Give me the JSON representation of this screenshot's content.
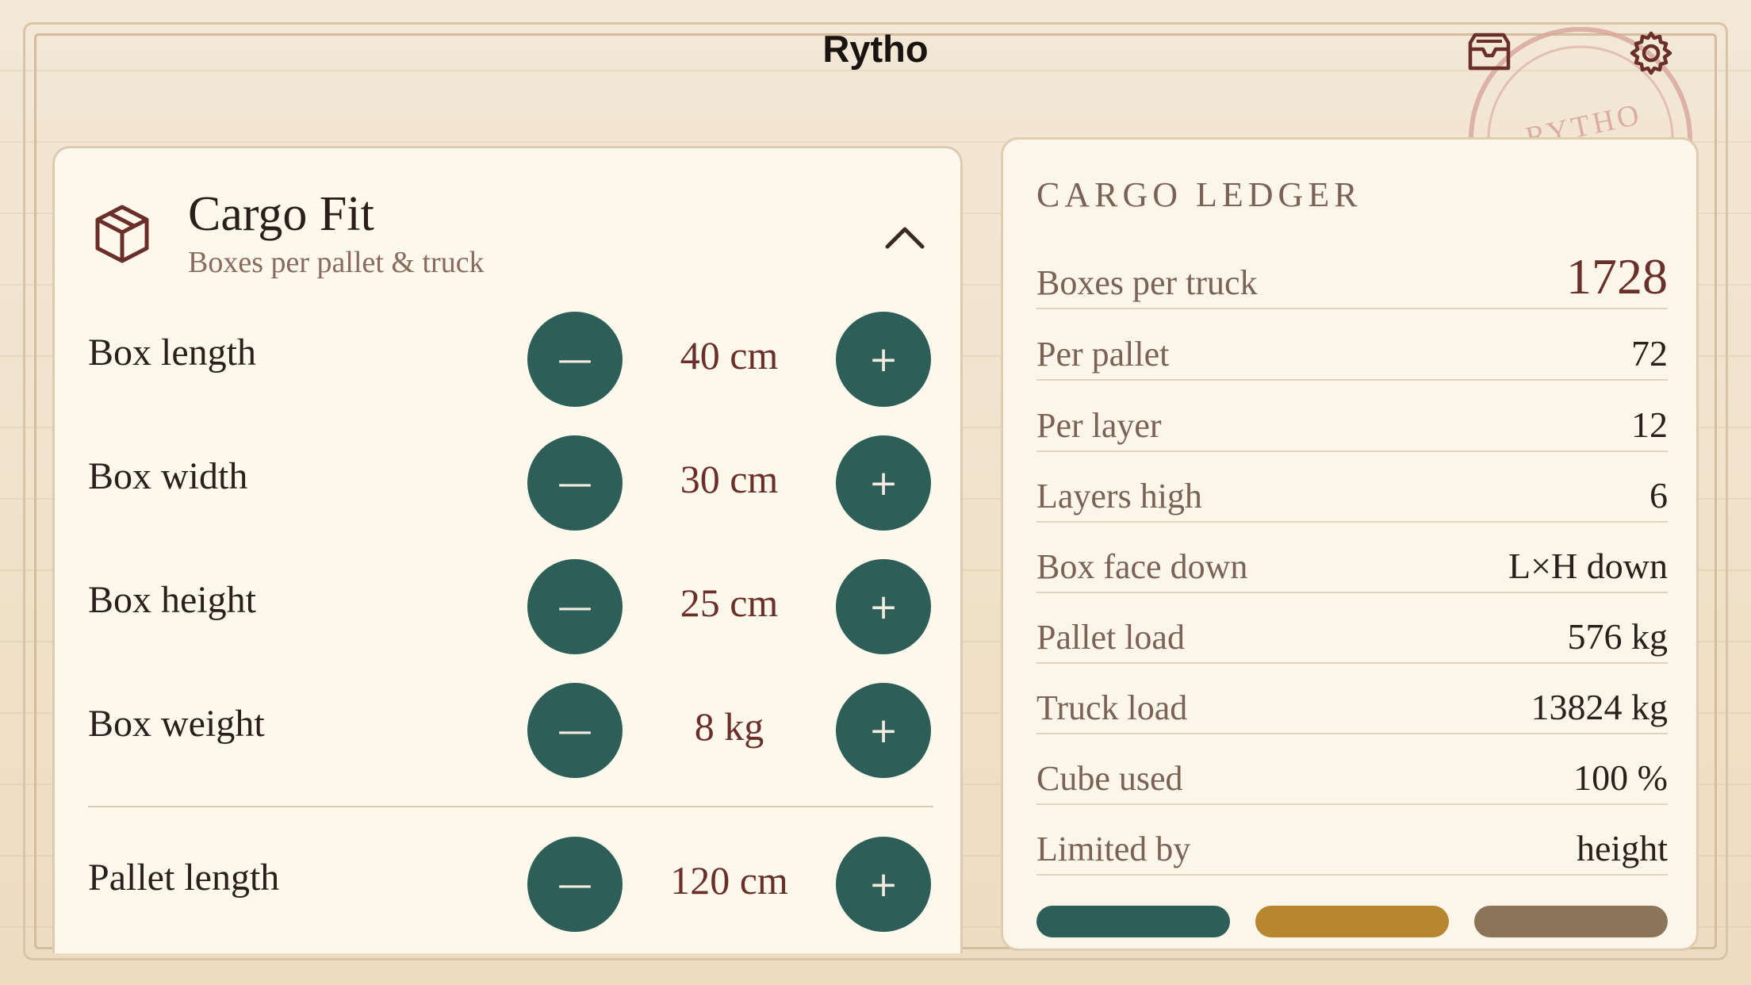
{
  "app": {
    "title": "Rytho"
  },
  "stamp": {
    "text": "RYTHO"
  },
  "cargo_fit": {
    "title": "Cargo Fit",
    "subtitle": "Boxes per pallet & truck",
    "inputs": [
      {
        "label": "Box length",
        "value": "40 cm"
      },
      {
        "label": "Box width",
        "value": "30 cm"
      },
      {
        "label": "Box height",
        "value": "25 cm"
      },
      {
        "label": "Box weight",
        "value": "8 kg"
      },
      {
        "label": "Pallet length",
        "value": "120 cm"
      }
    ],
    "minus_glyph": "—",
    "plus_glyph": "+"
  },
  "ledger": {
    "title": "CARGO LEDGER",
    "rows": [
      {
        "label": "Boxes per truck",
        "value": "1728"
      },
      {
        "label": "Per pallet",
        "value": "72"
      },
      {
        "label": "Per layer",
        "value": "12"
      },
      {
        "label": "Layers high",
        "value": "6"
      },
      {
        "label": "Box face down",
        "value": "L×H down"
      },
      {
        "label": "Pallet load",
        "value": "576 kg"
      },
      {
        "label": "Truck load",
        "value": "13824 kg"
      },
      {
        "label": "Cube used",
        "value": "100 %"
      },
      {
        "label": "Limited by",
        "value": "height"
      }
    ]
  },
  "colors": {
    "accent": "#2e5e58",
    "value_red": "#6b2f2a",
    "pill_teal": "#2e5e58",
    "pill_gold": "#b8862e",
    "pill_brown": "#8b7458"
  },
  "icons": {
    "inbox": "tray-icon",
    "settings": "gear-icon",
    "cargo": "box-icon",
    "collapse": "chevron-up-icon"
  }
}
